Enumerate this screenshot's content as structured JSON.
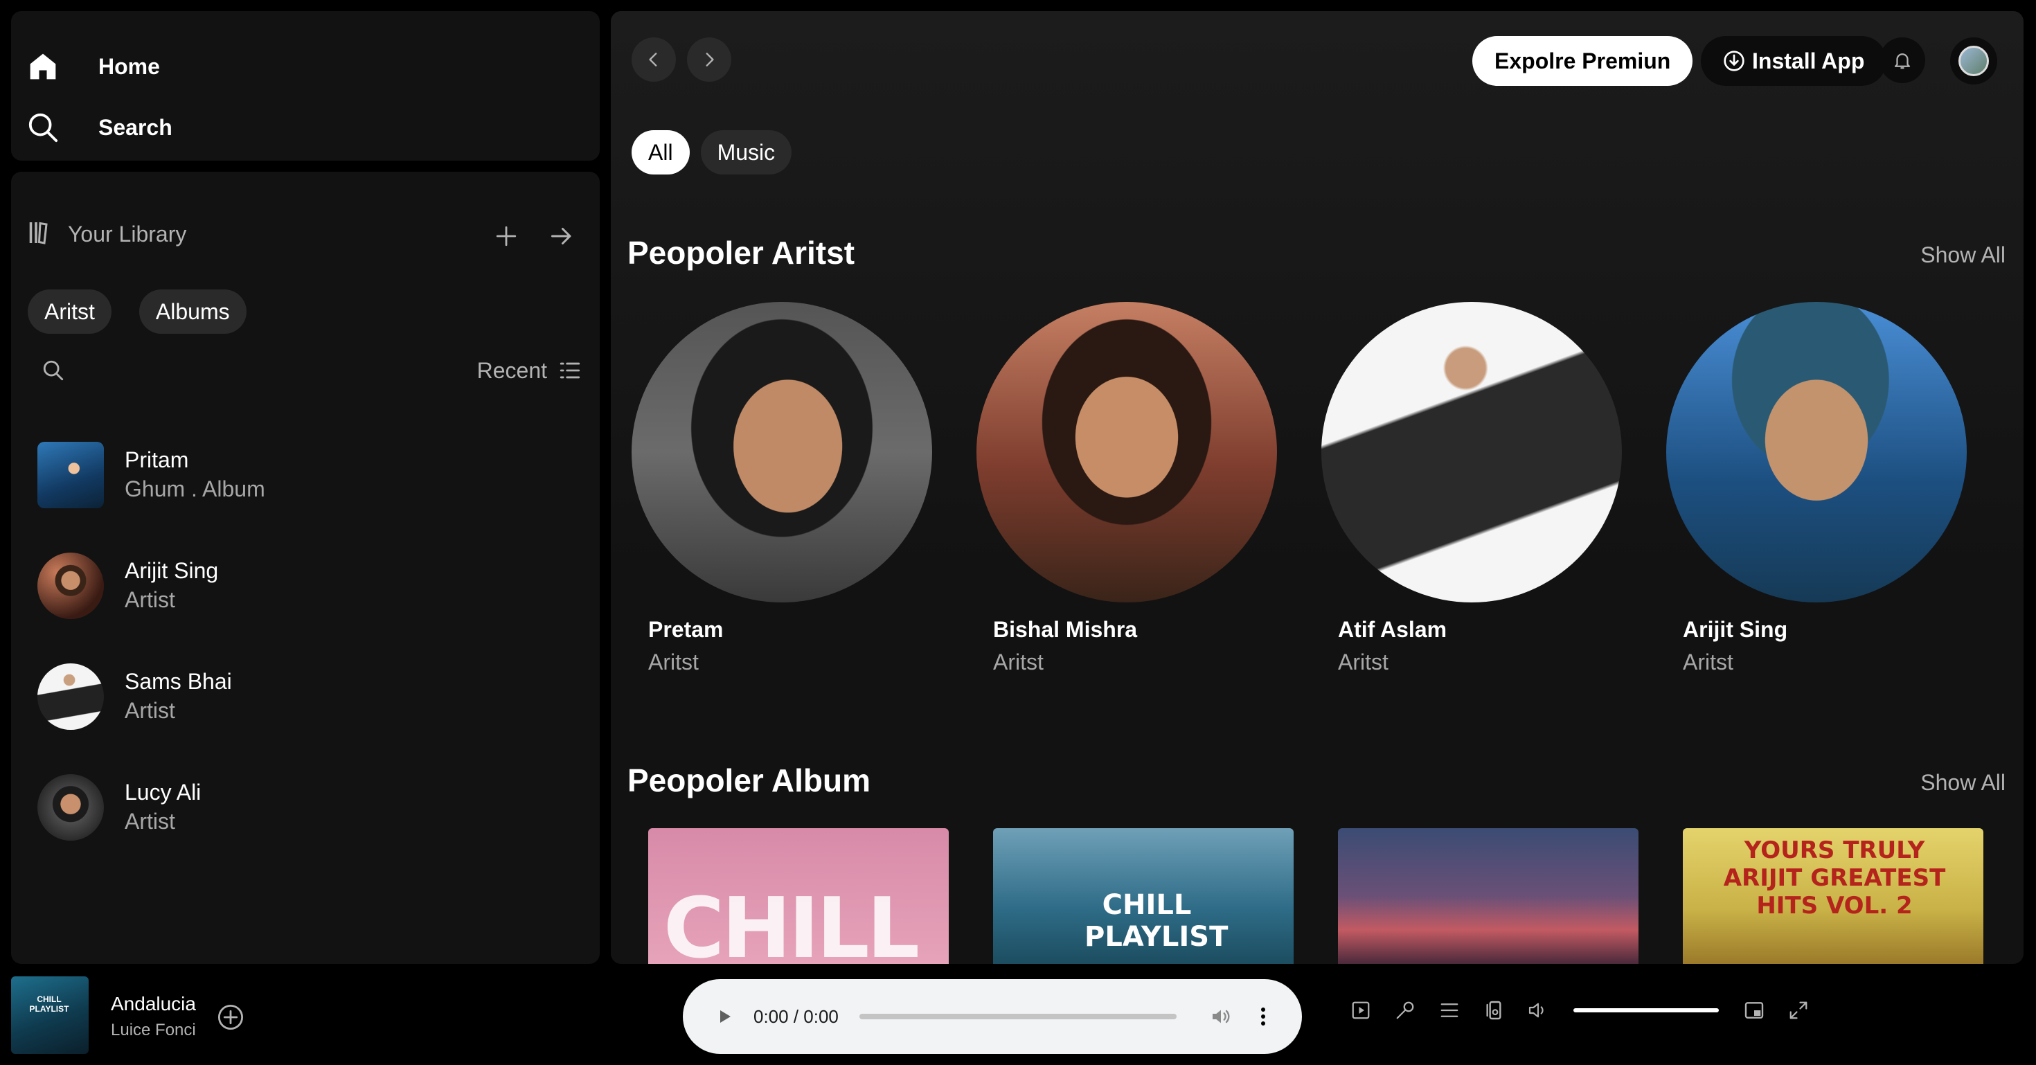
{
  "nav": {
    "home": "Home",
    "search": "Search"
  },
  "library": {
    "title": "Your Library",
    "chips": [
      "Aritst",
      "Albums"
    ],
    "sort_label": "Recent",
    "items": [
      {
        "title": "Pritam",
        "subtitle": "Ghum . Album"
      },
      {
        "title": "Arijit Sing",
        "subtitle": "Artist"
      },
      {
        "title": "Sams Bhai",
        "subtitle": "Artist"
      },
      {
        "title": "Lucy Ali",
        "subtitle": "Artist"
      }
    ]
  },
  "header": {
    "premium": "Expolre Premiun",
    "install": "Install App"
  },
  "filters": [
    "All",
    "Music"
  ],
  "sections": {
    "artists": {
      "title": "Peopoler Aritst",
      "show_all": "Show All"
    },
    "albums": {
      "title": "Peopoler Album",
      "show_all": "Show All"
    }
  },
  "artists": [
    {
      "name": "Pretam",
      "role": "Aritst"
    },
    {
      "name": "Bishal Mishra",
      "role": "Aritst"
    },
    {
      "name": "Atif Aslam",
      "role": "Aritst"
    },
    {
      "name": "Arijit Sing",
      "role": "Aritst"
    }
  ],
  "albums": [
    {
      "art_text": "CHILL"
    },
    {
      "art_text": "CHILL PLAYLIST"
    },
    {
      "art_text": ""
    },
    {
      "art_text": "YOURS TRULY ARIJIT GREATEST HITS VOL. 2"
    }
  ],
  "now_playing": {
    "title": "Andalucia",
    "artist": "Luice Fonci",
    "art_caption": "CHILL PLAYLIST"
  },
  "audio": {
    "time": "0:00 / 0:00",
    "volume": 1.0
  },
  "colors": {
    "background": "#000000",
    "panel": "#121212",
    "chip": "#2a2a2a",
    "muted_text": "#b3b3b3"
  }
}
